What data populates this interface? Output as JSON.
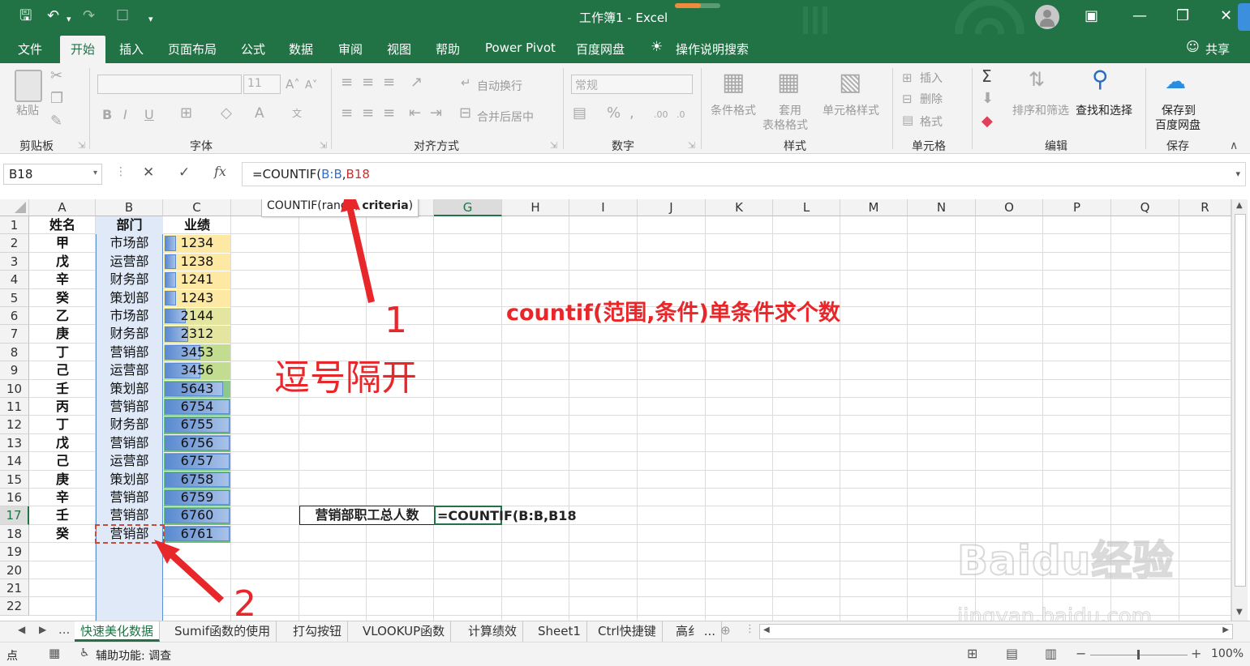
{
  "titlebar": {
    "title": "工作簿1  -  Excel",
    "account_avatar": "user-icon"
  },
  "tabs": [
    {
      "label": "文件"
    },
    {
      "label": "开始"
    },
    {
      "label": "插入"
    },
    {
      "label": "页面布局"
    },
    {
      "label": "公式"
    },
    {
      "label": "数据"
    },
    {
      "label": "审阅"
    },
    {
      "label": "视图"
    },
    {
      "label": "帮助"
    },
    {
      "label": "Power Pivot"
    },
    {
      "label": "百度网盘"
    }
  ],
  "tellme": "操作说明搜索",
  "share": "共享",
  "ribbon": {
    "paste": "粘贴",
    "font_size": "11",
    "number_format": "常规",
    "wrap_text": "自动换行",
    "merge_center": "合并后居中",
    "conditional_format": "条件格式",
    "table_format_1": "套用",
    "table_format_2": "表格格式",
    "cell_styles": "单元格样式",
    "insert": "插入",
    "delete": "删除",
    "format": "格式",
    "sort_filter": "排序和筛选",
    "find_select": "查找和选择",
    "save_to_1": "保存到",
    "save_to_2": "百度网盘",
    "groups": {
      "clipboard": "剪贴板",
      "font": "字体",
      "alignment": "对齐方式",
      "number": "数字",
      "styles": "样式",
      "cells": "单元格",
      "editing": "编辑",
      "save": "保存"
    }
  },
  "formula_bar": {
    "name_box": "B18",
    "fx": "fx",
    "formula_prefix": "=COUNTIF(",
    "formula_range": "B:B",
    "formula_comma": ",",
    "formula_ref": "B18",
    "tooltip_fn": "COUNTIF(range, ",
    "tooltip_arg": "criteria",
    "tooltip_end": ")"
  },
  "columns": [
    "A",
    "B",
    "C",
    "D",
    "E",
    "F",
    "G",
    "H",
    "I",
    "J",
    "K",
    "L",
    "M",
    "N",
    "O",
    "P",
    "Q",
    "R"
  ],
  "rows": [
    "1",
    "2",
    "3",
    "4",
    "5",
    "6",
    "7",
    "8",
    "9",
    "10",
    "11",
    "12",
    "13",
    "14",
    "15",
    "16",
    "17",
    "18",
    "19",
    "20",
    "21",
    "22"
  ],
  "table": {
    "headers": [
      "姓名",
      "部门",
      "业绩"
    ],
    "data": [
      {
        "name": "甲",
        "dept": "市场部",
        "score": "1234",
        "bar": 0.18,
        "bg": "#fde9a4"
      },
      {
        "name": "戊",
        "dept": "运营部",
        "score": "1238",
        "bar": 0.18,
        "bg": "#fde9a4"
      },
      {
        "name": "辛",
        "dept": "财务部",
        "score": "1241",
        "bar": 0.18,
        "bg": "#fde9a4"
      },
      {
        "name": "癸",
        "dept": "策划部",
        "score": "1243",
        "bar": 0.18,
        "bg": "#fde9a4"
      },
      {
        "name": "乙",
        "dept": "市场部",
        "score": "2144",
        "bar": 0.33,
        "bg": "#e4e6a0"
      },
      {
        "name": "庚",
        "dept": "财务部",
        "score": "2312",
        "bar": 0.36,
        "bg": "#e4e6a0"
      },
      {
        "name": "丁",
        "dept": "营销部",
        "score": "3453",
        "bar": 0.55,
        "bg": "#c2dc90"
      },
      {
        "name": "己",
        "dept": "运营部",
        "score": "3456",
        "bar": 0.55,
        "bg": "#c2dc90"
      },
      {
        "name": "壬",
        "dept": "策划部",
        "score": "5643",
        "bar": 0.9,
        "bg": "#8cc98a"
      },
      {
        "name": "丙",
        "dept": "营销部",
        "score": "6754",
        "bar": 1.0,
        "bg": "#6fbf80"
      },
      {
        "name": "丁",
        "dept": "财务部",
        "score": "6755",
        "bar": 1.0,
        "bg": "#6fbf80"
      },
      {
        "name": "戊",
        "dept": "营销部",
        "score": "6756",
        "bar": 1.0,
        "bg": "#6fbf80"
      },
      {
        "name": "己",
        "dept": "运营部",
        "score": "6757",
        "bar": 1.0,
        "bg": "#6fbf80"
      },
      {
        "name": "庚",
        "dept": "策划部",
        "score": "6758",
        "bar": 1.0,
        "bg": "#6fbf80"
      },
      {
        "name": "辛",
        "dept": "营销部",
        "score": "6759",
        "bar": 1.0,
        "bg": "#6fbf80"
      },
      {
        "name": "壬",
        "dept": "营销部",
        "score": "6760",
        "bar": 1.0,
        "bg": "#6fbf80"
      },
      {
        "name": "癸",
        "dept": "营销部",
        "score": "6761",
        "bar": 1.0,
        "bg": "#6fbf80"
      }
    ]
  },
  "label_cell": "营销部职工总人数",
  "edit_cell": "=COUNTIF(B:B,B18",
  "annotations": {
    "red_note": "countif(范围,条件)单条件求个数",
    "comma_note": "逗号隔开",
    "num1": "1",
    "num2": "2"
  },
  "watermark": {
    "text": "Baidu经验",
    "url": "jingyan.baidu.com"
  },
  "sheet_tabs": [
    "快速美化数据",
    "Sumif函数的使用",
    "打勾按钮",
    "VLOOKUP函数",
    "计算绩效",
    "Sheet1",
    "Ctrl快捷键",
    "高纟 ..."
  ],
  "statusbar": {
    "mode": "点",
    "accessibility": "辅助功能: 调查",
    "zoom": "100%"
  },
  "colors": {
    "excel_green": "#217346",
    "annotation_red": "#e8272b",
    "blue_ref": "#2f6fd6",
    "red_ref": "#c9302c"
  }
}
